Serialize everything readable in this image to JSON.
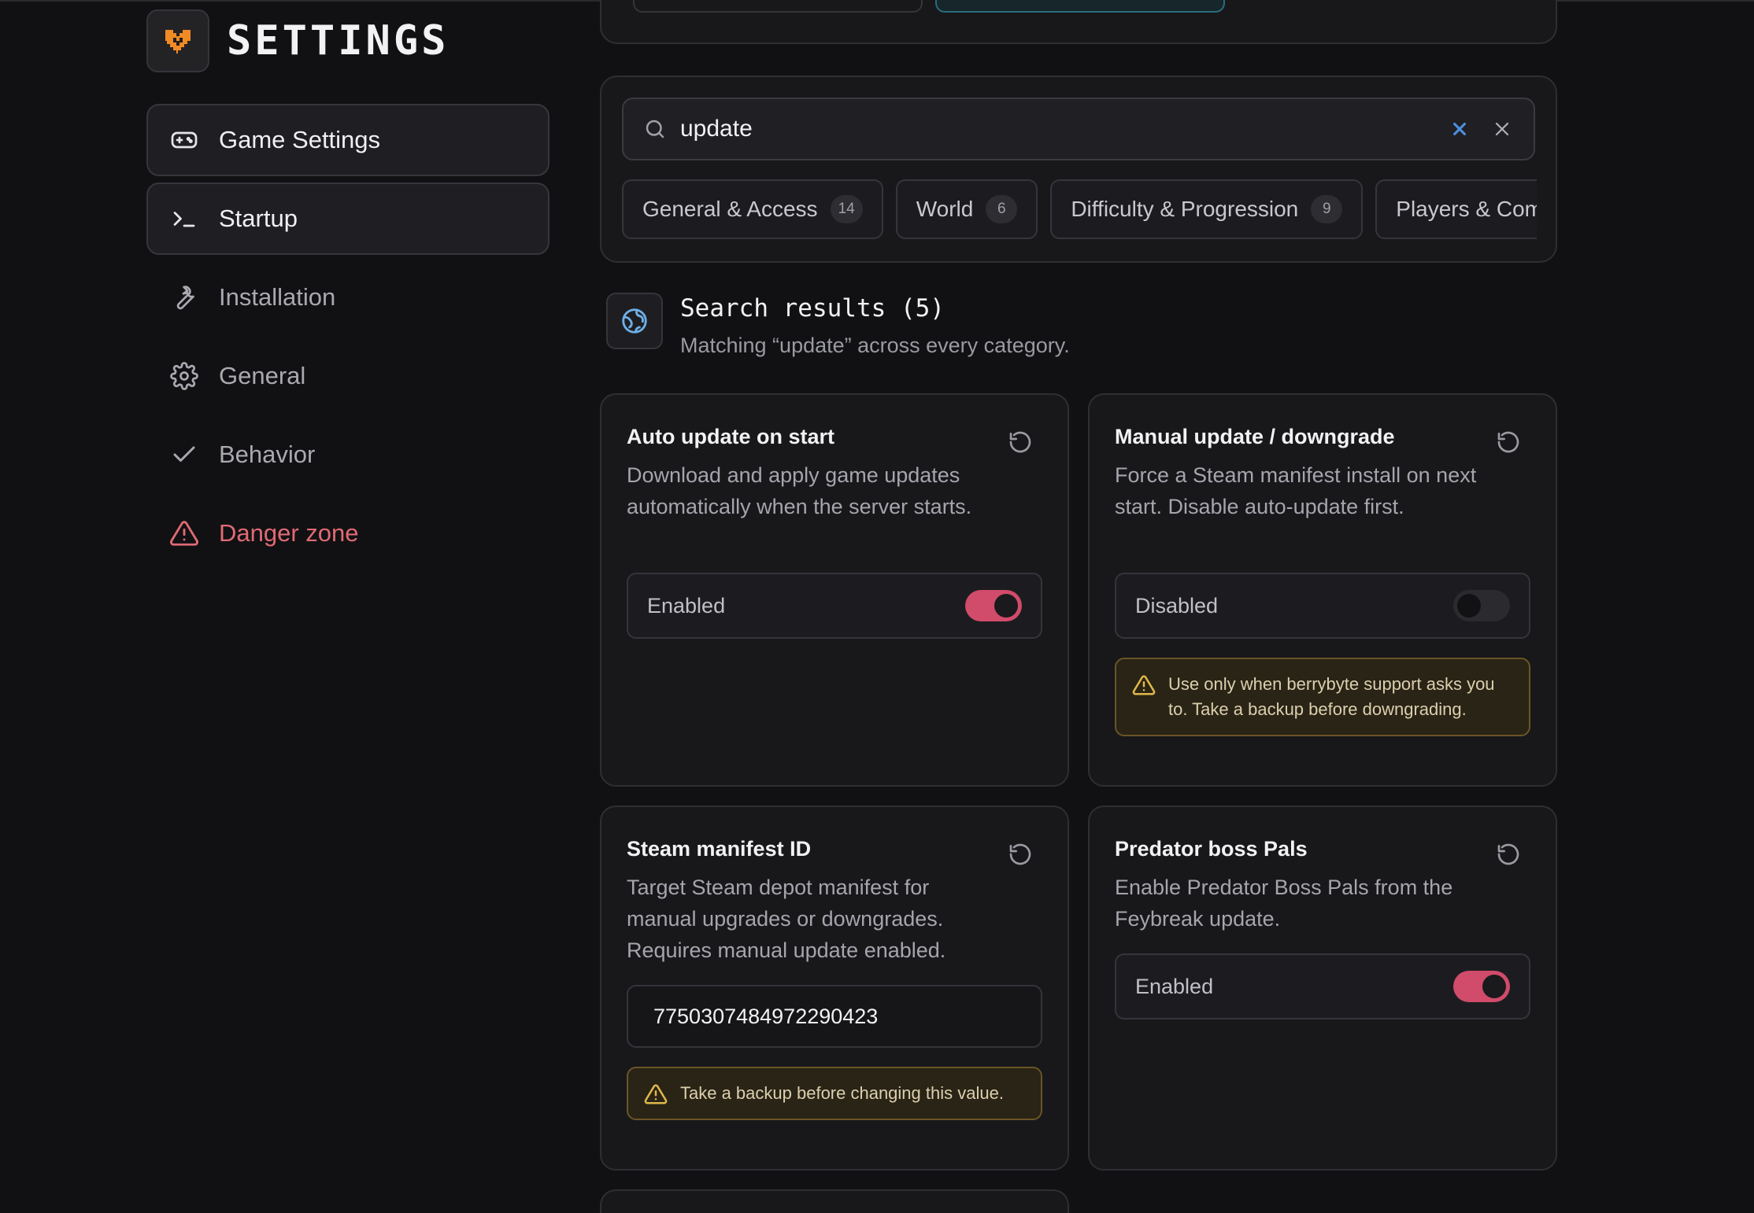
{
  "brand": {
    "title": "SETTINGS",
    "logo": "heart-shield-logo"
  },
  "sidebar": {
    "items": [
      {
        "label": "Game Settings",
        "icon": "gamepad-icon"
      },
      {
        "label": "Startup",
        "icon": "terminal-icon"
      },
      {
        "label": "Installation",
        "icon": "wrench-icon"
      },
      {
        "label": "General",
        "icon": "gear-icon"
      },
      {
        "label": "Behavior",
        "icon": "check-icon"
      },
      {
        "label": "Danger zone",
        "icon": "warning-icon"
      }
    ]
  },
  "search": {
    "value": "update"
  },
  "categories": [
    {
      "label": "General & Access",
      "count": "14"
    },
    {
      "label": "World",
      "count": "6"
    },
    {
      "label": "Difficulty & Progression",
      "count": "9"
    },
    {
      "label": "Players & Combat",
      "count": ""
    }
  ],
  "results": {
    "title": "Search results (5)",
    "subtitle": "Matching “update” across every category."
  },
  "cards": {
    "auto_update": {
      "title": "Auto update on start",
      "description": "Download and apply game updates automatically when the server starts.",
      "state": "Enabled",
      "on": true
    },
    "manual_update": {
      "title": "Manual update / downgrade",
      "description": "Force a Steam manifest install on next start. Disable auto-update first.",
      "state": "Disabled",
      "on": false,
      "warning": "Use only when berrybyte support asks you to. Take a backup before downgrading."
    },
    "manifest": {
      "title": "Steam manifest ID",
      "description": "Target Steam depot manifest for manual upgrades or downgrades. Requires manual update enabled.",
      "value": "7750307484972290423",
      "warning": "Take a backup before changing this value."
    },
    "predator": {
      "title": "Predator boss Pals",
      "description": "Enable Predator Boss Pals from the Feybreak update.",
      "state": "Enabled",
      "on": true
    }
  },
  "colors": {
    "accent": "#d14b6a",
    "danger": "#e06a74",
    "warning": "#e0b84a",
    "brand_orange": "#f08a24",
    "info_blue": "#4f8fe0"
  }
}
